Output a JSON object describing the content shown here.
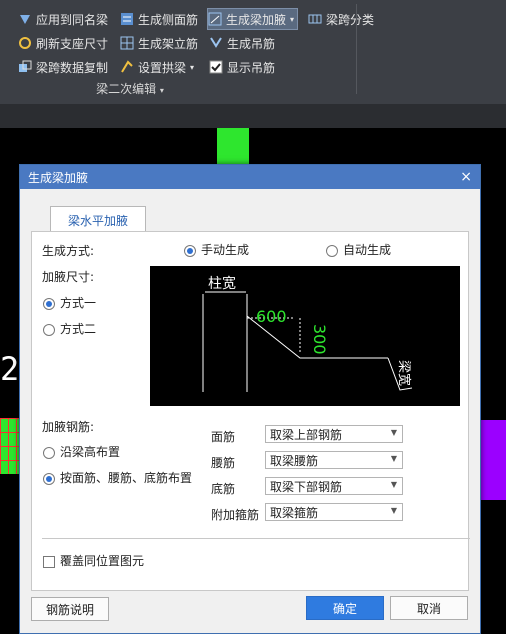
{
  "ribbon": {
    "items": [
      {
        "label": "应用到同名梁",
        "icon": "apply-icon"
      },
      {
        "label": "刷新支座尺寸",
        "icon": "refresh-icon"
      },
      {
        "label": "梁跨数据复制",
        "icon": "copy-icon"
      },
      {
        "label": "生成侧面筋",
        "icon": "side-bar-icon"
      },
      {
        "label": "生成架立筋",
        "icon": "stand-bar-icon"
      },
      {
        "label": "设置拱梁",
        "icon": "arch-icon"
      },
      {
        "label": "生成梁加腋",
        "icon": "haunch-icon"
      },
      {
        "label": "生成吊筋",
        "icon": "hanger-icon"
      },
      {
        "label": "显示吊筋",
        "icon": "checkbox-icon"
      },
      {
        "label": "梁跨分类",
        "icon": "classify-icon"
      }
    ],
    "group_label": "梁二次编辑"
  },
  "canvas": {
    "text": "2;"
  },
  "dialog": {
    "title": "生成梁加腋",
    "close": "×",
    "tab": "梁水平加腋",
    "mode_label": "生成方式:",
    "mode_manual": "手动生成",
    "mode_auto": "自动生成",
    "size_label": "加腋尺寸:",
    "size_opt1": "方式一",
    "size_opt2": "方式二",
    "diagram": {
      "col_width": "柱宽",
      "dim1": "600",
      "dim2": "300",
      "beam_width": "梁宽"
    },
    "rebar_label": "加腋钢筋:",
    "rebar_opt1": "沿梁高布置",
    "rebar_opt2": "按面筋、腰筋、底筋布置",
    "rows": [
      {
        "label": "面筋",
        "value": "取梁上部钢筋"
      },
      {
        "label": "腰筋",
        "value": "取梁腰筋"
      },
      {
        "label": "底筋",
        "value": "取梁下部钢筋"
      },
      {
        "label": "附加箍筋",
        "value": "取梁箍筋"
      }
    ],
    "overwrite": "覆盖同位置图元",
    "help_btn": "钢筋说明",
    "ok_btn": "确定",
    "cancel_btn": "取消"
  }
}
